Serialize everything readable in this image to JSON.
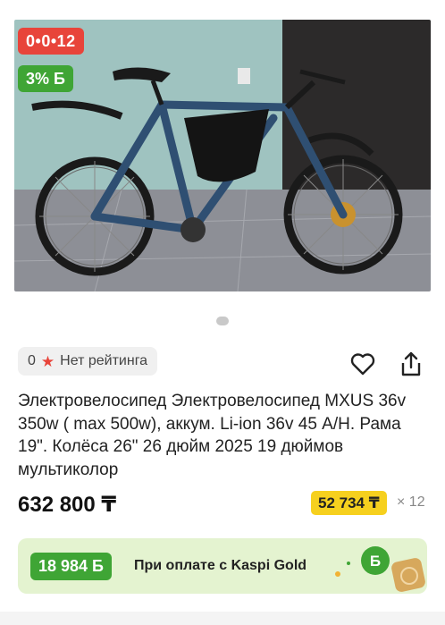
{
  "gallery": {
    "timer_badge": "0•0•12",
    "bonus_badge": "3% Б"
  },
  "rating": {
    "count": "0",
    "label": "Нет рейтинга"
  },
  "product": {
    "title": "Электровелосипед Электровелосипед MXUS 36v 350w ( max 500w), аккум. Li-ion 36v 45 А/Н. Рама 19\". Колёса 26\" 26 дюйм 2025 19 дюймов мультиколор",
    "price": "632 800 ₸",
    "installment_amount": "52 734 ₸",
    "installment_multiplier": "× 12"
  },
  "kaspi_gold": {
    "bonus_amount": "18 984 Б",
    "text": "При оплате с Kaspi Gold"
  },
  "colors": {
    "accent_red": "#e8443a",
    "accent_green": "#3fa535",
    "installment_yellow": "#f6d01e",
    "banner_bg": "#e4f3d0"
  },
  "icons": [
    "star-icon",
    "heart-icon",
    "share-icon",
    "kaspi-bonus-icon"
  ]
}
